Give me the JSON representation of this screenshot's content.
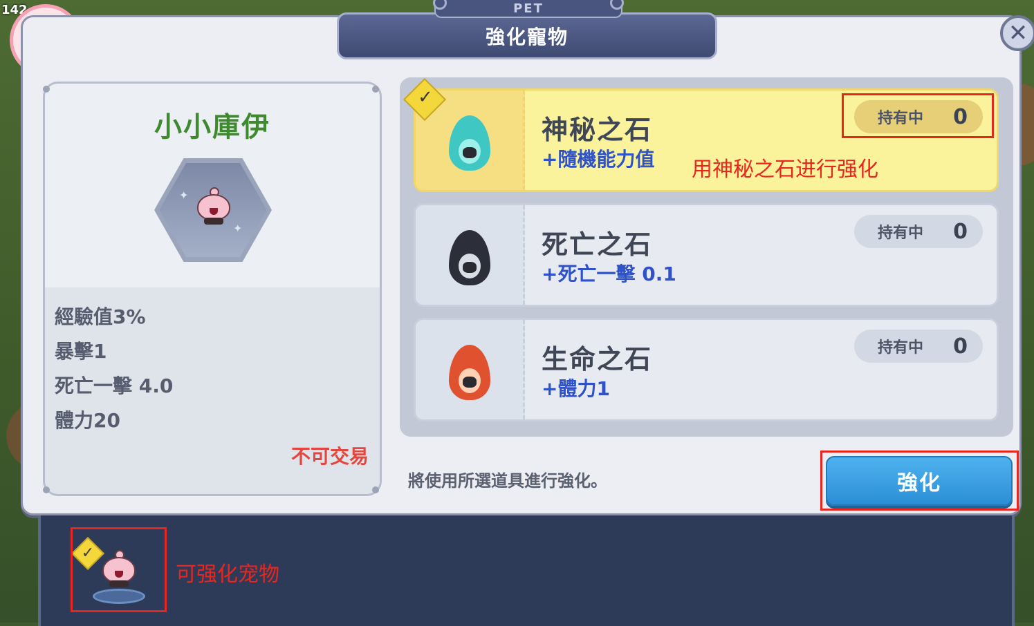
{
  "background": {
    "top_left_number": "142"
  },
  "window": {
    "tag": "PET",
    "title": "強化寵物",
    "close_label": "✕"
  },
  "pet": {
    "name": "小小庫伊",
    "stats": [
      "經驗值3%",
      "暴擊1",
      "死亡一擊 4.0",
      "體力20"
    ],
    "trade_status": "不可交易"
  },
  "stones": [
    {
      "name": "神秘之石",
      "effect": "+隨機能力值",
      "owned_label": "持有中",
      "owned_count": "0",
      "selected": true,
      "flame_color": "#3fc7c4"
    },
    {
      "name": "死亡之石",
      "effect": "+死亡一擊 0.1",
      "owned_label": "持有中",
      "owned_count": "0",
      "selected": false,
      "flame_color": "#2c2f3a"
    },
    {
      "name": "生命之石",
      "effect": "+體力1",
      "owned_label": "持有中",
      "owned_count": "0",
      "selected": false,
      "flame_color": "#e0512f"
    }
  ],
  "footer": {
    "hint": "將使用所選道具進行強化。",
    "enhance_button": "強化"
  },
  "annotations": {
    "stone_note": "用神秘之石进行强化",
    "pet_note": "可强化宠物"
  },
  "colors": {
    "accent_blue": "#2f8fd8",
    "selected_yellow": "#fbf39c",
    "name_green": "#3f8a2f",
    "annotation_red": "#e8261f"
  }
}
